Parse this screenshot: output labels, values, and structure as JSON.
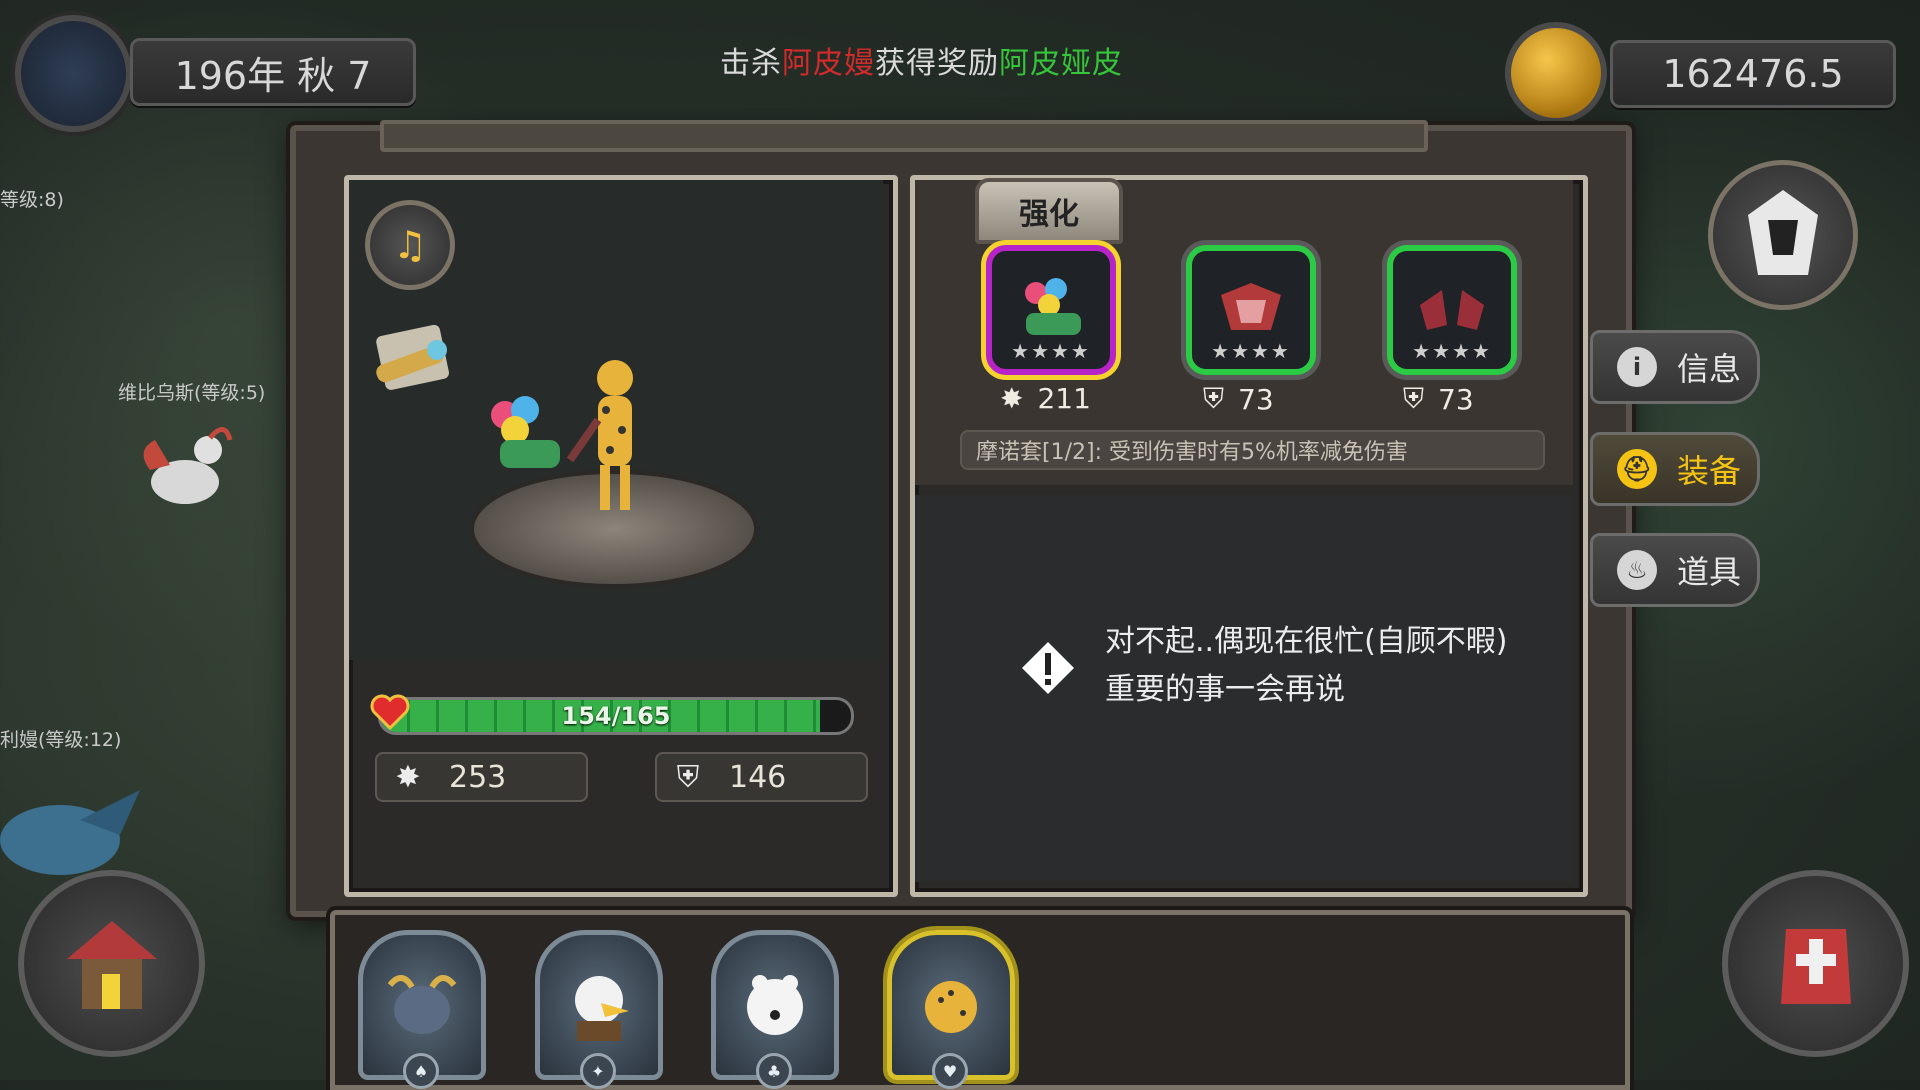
{
  "hud": {
    "date": "196年 秋 7",
    "coins": "162476.5"
  },
  "kill_message": {
    "prefix": "击杀",
    "enemy": "阿皮嫚",
    "mid": "获得奖励",
    "reward": "阿皮娅皮"
  },
  "world_labels": {
    "label_1": "等级:8)",
    "label_2": "维比乌斯(等级:5)",
    "label_3": "利嫚(等级:12)"
  },
  "hero": {
    "hp_current": 154,
    "hp_max": 165,
    "hp_text": "154/165",
    "attack": "253",
    "defense": "146"
  },
  "equipment": {
    "strengthen_tab": "强化",
    "slots": [
      {
        "name": "flower-weapon",
        "value": "211",
        "stat": "attack",
        "stars": "★★★★",
        "rarity": "purple"
      },
      {
        "name": "red-armor",
        "value": "73",
        "stat": "defense",
        "stars": "★★★★",
        "rarity": "green"
      },
      {
        "name": "red-gloves",
        "value": "73",
        "stat": "defense",
        "stars": "★★★★",
        "rarity": "green"
      }
    ],
    "set_bonus": "摩诺套[1/2]: 受到伤害时有5%机率减免伤害"
  },
  "message": "对不起..偶现在很忙(自顾不暇)重要的事一会再说",
  "side_menu": {
    "info": "信息",
    "equip": "装备",
    "items": "道具"
  },
  "colors": {
    "purple_rarity": "#b523c9",
    "green_rarity": "#2bcb45",
    "active_gold": "#f4c313",
    "hp_green": "#36b14a"
  }
}
